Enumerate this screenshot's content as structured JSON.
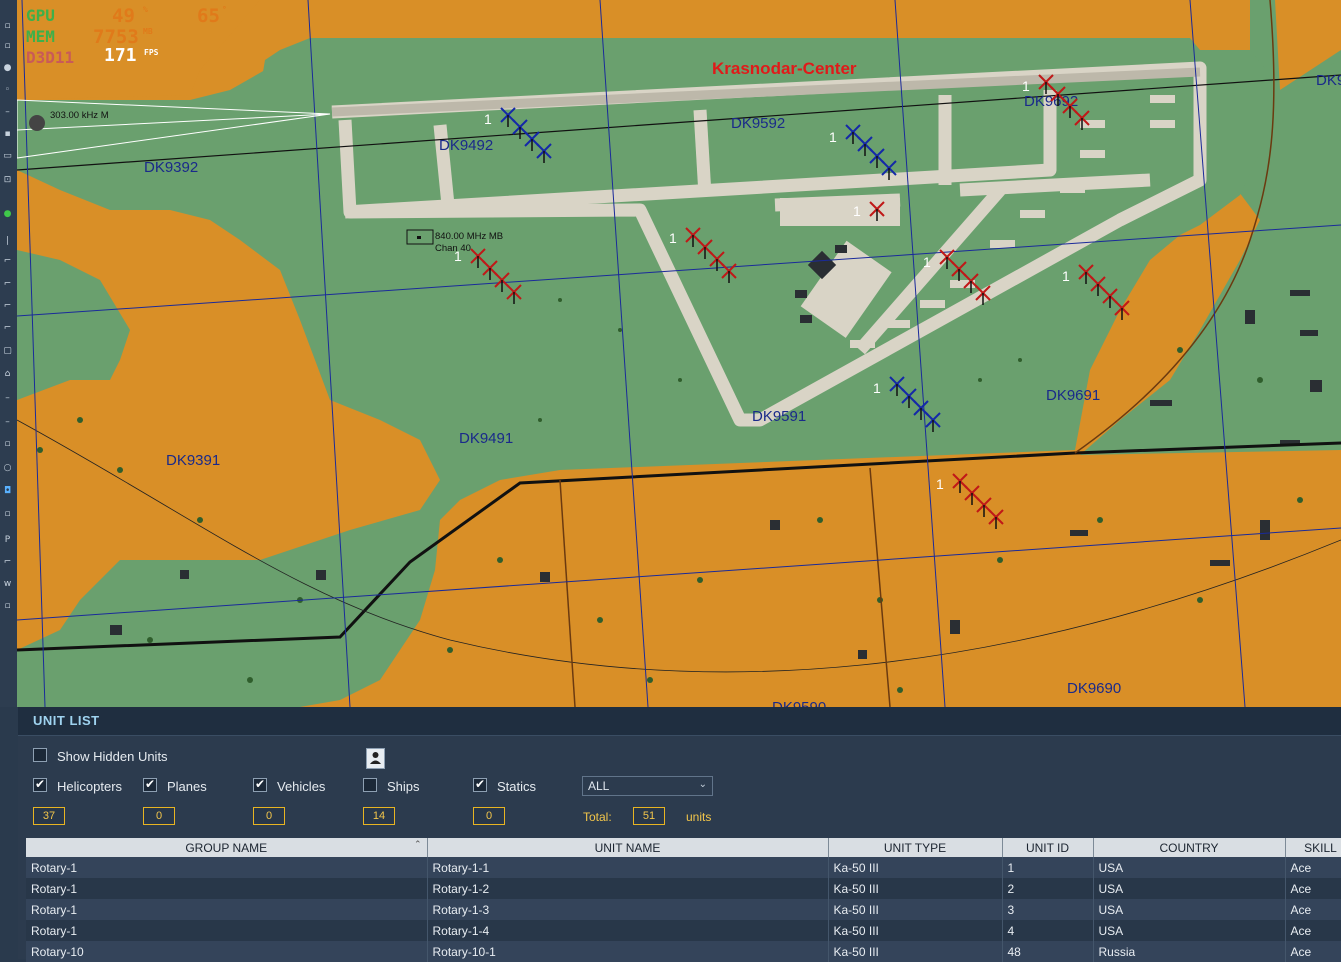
{
  "hud": {
    "gpu_label": "GPU",
    "gpu_pct": "49",
    "gpu_pct_unit": "%",
    "gpu_temp": "65",
    "gpu_temp_unit": "°",
    "mem_label": "MEM",
    "mem_value": "7753",
    "mem_unit": "MB",
    "api_label": "D3D11",
    "fps_value": "171",
    "fps_label": "FPS"
  },
  "map": {
    "airport_label": "Krasnodar-Center",
    "ndb_label": "303.00 kHz M",
    "tacan_freq": "840.00 MHz MB",
    "tacan_chan": "Chan 40",
    "grid_labels": [
      "DK9392",
      "DK9492",
      "DK9592",
      "DK9692",
      "DK9391",
      "DK9491",
      "DK9591",
      "DK9691",
      "DK9690",
      "DK9590",
      "DK9"
    ],
    "unit_group_count": "1",
    "colors": {
      "blue_units": "#1428a8",
      "red_units": "#c01818",
      "urban": "#d98f27",
      "field": "#6aa06e"
    }
  },
  "unit_list": {
    "title": "UNIT LIST",
    "show_hidden_label": "Show Hidden Units",
    "show_hidden_checked": false,
    "filters": [
      {
        "label": "Helicopters",
        "checked": true,
        "count": "37"
      },
      {
        "label": "Planes",
        "checked": true,
        "count": "0"
      },
      {
        "label": "Vehicles",
        "checked": true,
        "count": "0"
      },
      {
        "label": "Ships",
        "checked": false,
        "count": "14"
      },
      {
        "label": "Statics",
        "checked": true,
        "count": "0"
      }
    ],
    "coalition_select": "ALL",
    "total_label": "Total:",
    "total_value": "51",
    "units_label": "units",
    "columns": [
      "GROUP NAME",
      "UNIT NAME",
      "UNIT TYPE",
      "UNIT ID",
      "COUNTRY",
      "SKILL"
    ],
    "rows": [
      [
        "Rotary-1",
        "Rotary-1-1",
        "Ka-50 III",
        "1",
        "USA",
        "Ace"
      ],
      [
        "Rotary-1",
        "Rotary-1-2",
        "Ka-50 III",
        "2",
        "USA",
        "Ace"
      ],
      [
        "Rotary-1",
        "Rotary-1-3",
        "Ka-50 III",
        "3",
        "USA",
        "Ace"
      ],
      [
        "Rotary-1",
        "Rotary-1-4",
        "Ka-50 III",
        "4",
        "USA",
        "Ace"
      ],
      [
        "Rotary-10",
        "Rotary-10-1",
        "Ka-50 III",
        "48",
        "Russia",
        "Ace"
      ]
    ]
  }
}
